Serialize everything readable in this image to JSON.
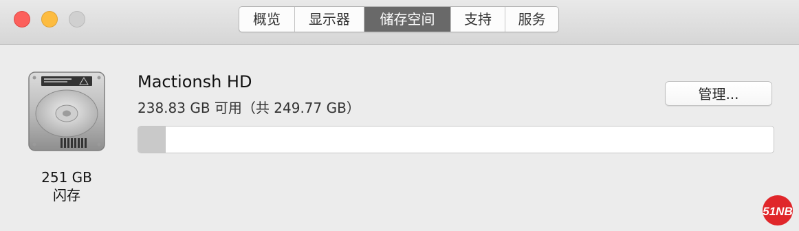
{
  "window": {
    "traffic_lights": {
      "close": "#fc605c",
      "minimize": "#fdbc40",
      "zoom": "#d0d0d0"
    },
    "tabs": [
      {
        "label": "概览",
        "active": false
      },
      {
        "label": "显示器",
        "active": false
      },
      {
        "label": "储存空间",
        "active": true
      },
      {
        "label": "支持",
        "active": false
      },
      {
        "label": "服务",
        "active": false
      }
    ]
  },
  "storage": {
    "drive": {
      "icon": "hard-drive-icon",
      "capacity": "251 GB",
      "type": "闪存"
    },
    "disk_name": "Mactionsh HD",
    "availability": "238.83 GB 可用（共 249.77 GB）",
    "manage_label": "管理...",
    "used_fraction": 0.0437,
    "used_color": "#c9c9c9"
  },
  "watermark": {
    "icon": "51nb-logo-icon",
    "text": "51NB",
    "color": "#e0262a"
  }
}
